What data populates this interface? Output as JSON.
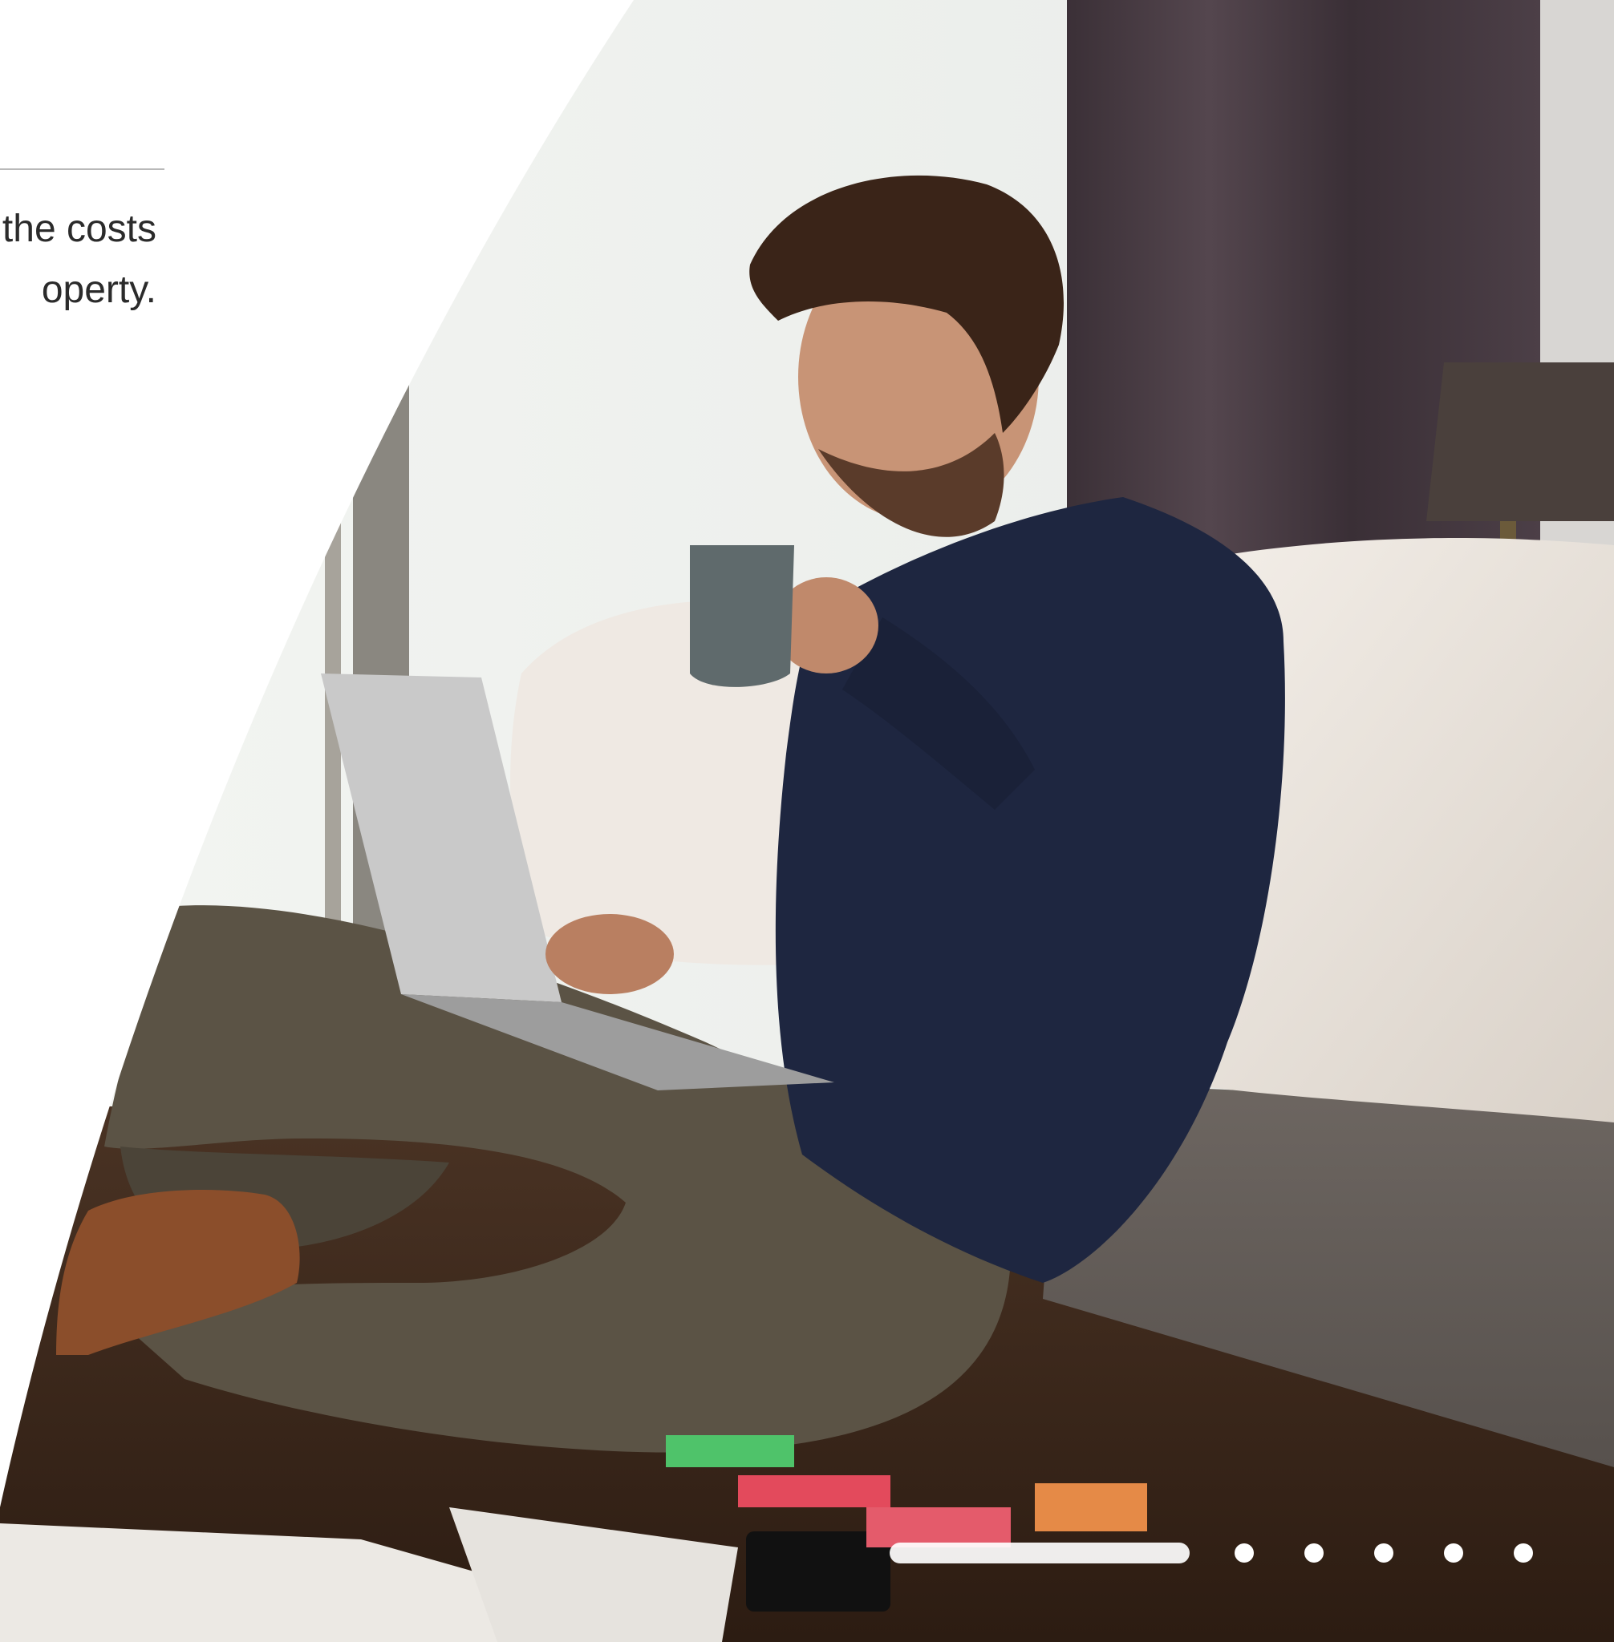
{
  "intro": {
    "lines": [
      "the costs",
      "operty."
    ]
  },
  "hero_image": {
    "description_icon": "photo-man-with-laptop-and-mug"
  },
  "carousel": {
    "active_index": 0,
    "count": 6
  },
  "colors": {
    "background": "#ffffff",
    "text": "#2b2b2b",
    "rule": "#b9b9b9",
    "indicator": "#ffffff"
  }
}
